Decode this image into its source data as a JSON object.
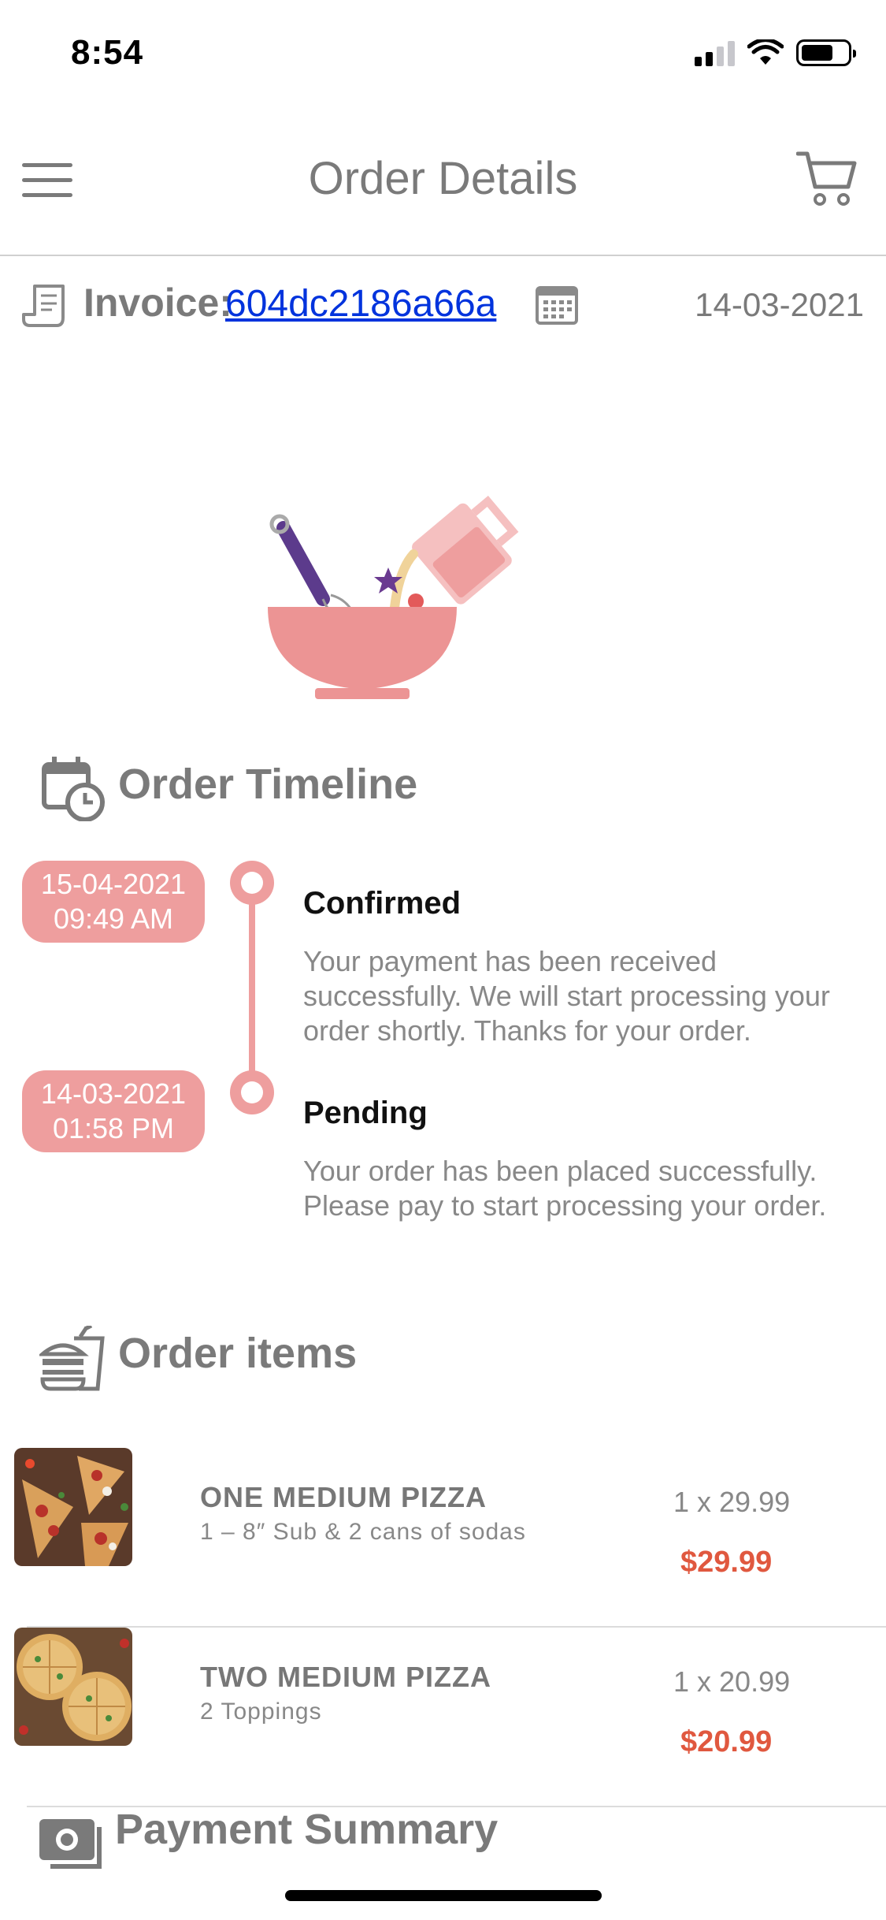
{
  "status_bar": {
    "time": "8:54"
  },
  "nav": {
    "title": "Order Details"
  },
  "invoice": {
    "label": "Invoice:",
    "id": "604dc2186a66a",
    "date": "14-03-2021"
  },
  "timeline": {
    "title": "Order Timeline",
    "events": [
      {
        "date": "15-04-2021",
        "time": "09:49 AM",
        "status": "Confirmed",
        "description": "Your payment has been received successfully. We will start processing your order shortly. Thanks for your order."
      },
      {
        "date": "14-03-2021",
        "time": "01:58 PM",
        "status": "Pending",
        "description": "Your order has been placed successfully. Please pay to start processing your order."
      }
    ]
  },
  "order_items": {
    "title": "Order items",
    "items": [
      {
        "name": "ONE MEDIUM PIZZA",
        "description": "1 – 8″ Sub & 2 cans of sodas",
        "qty": "1 x 29.99",
        "total": "$29.99"
      },
      {
        "name": "TWO MEDIUM PIZZA",
        "description": "2 Toppings",
        "qty": "1 x 20.99",
        "total": "$20.99"
      }
    ]
  },
  "payment_summary": {
    "title": "Payment Summary"
  },
  "colors": {
    "accent": "#ee9e9e",
    "price": "#e0583f",
    "link": "#0033dd",
    "text": "#7a7a7a"
  },
  "icons": [
    "menu-icon",
    "cart-icon",
    "receipt-icon",
    "calendar-icon",
    "calendar-clock-icon",
    "food-icon",
    "payment-icon"
  ]
}
